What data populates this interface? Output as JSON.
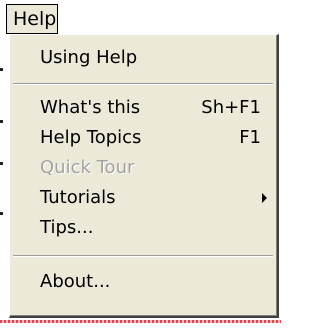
{
  "menubar": {
    "title": "Help"
  },
  "menu": {
    "items": [
      {
        "label": "Using Help",
        "shortcut": "",
        "enabled": true,
        "has_submenu": false
      },
      {
        "label": "What's this",
        "shortcut": "Sh+F1",
        "enabled": true,
        "has_submenu": false
      },
      {
        "label": "Help Topics",
        "shortcut": "F1",
        "enabled": true,
        "has_submenu": false
      },
      {
        "label": "Quick Tour",
        "shortcut": "",
        "enabled": false,
        "has_submenu": false
      },
      {
        "label": "Tutorials",
        "shortcut": "",
        "enabled": true,
        "has_submenu": true
      },
      {
        "label": "Tips...",
        "shortcut": "",
        "enabled": true,
        "has_submenu": false
      },
      {
        "label": "About...",
        "shortcut": "",
        "enabled": true,
        "has_submenu": false
      }
    ]
  },
  "colors": {
    "menu_background": "#ece9d8",
    "disabled_text": "#a3a3a3"
  }
}
